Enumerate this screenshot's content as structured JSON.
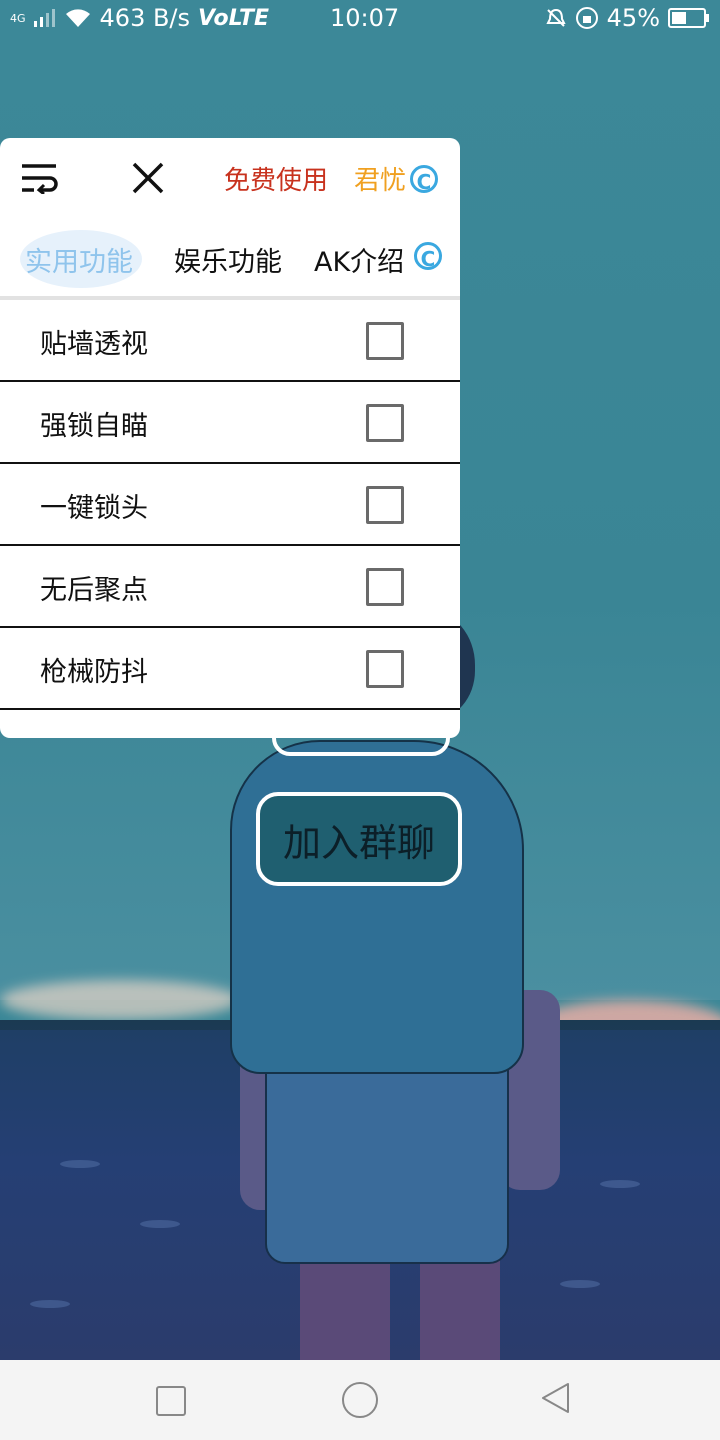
{
  "status_bar": {
    "network": "4G",
    "speed": "463 B/s",
    "volte": "VoLTE",
    "time": "10:07",
    "battery_percent": "45%",
    "battery_level": 0.45
  },
  "panel": {
    "free_label": "免费使用",
    "brand_label": "君忧",
    "brand_icon_letter": "C",
    "tabs": [
      {
        "label": "实用功能",
        "active": true
      },
      {
        "label": "娱乐功能",
        "active": false
      },
      {
        "label": "AK介绍",
        "active": false
      }
    ],
    "tab_icon_letter": "C",
    "items": [
      {
        "label": "贴墙透视",
        "checked": false
      },
      {
        "label": "强锁自瞄",
        "checked": false
      },
      {
        "label": "一键锁头",
        "checked": false
      },
      {
        "label": "无后聚点",
        "checked": false
      },
      {
        "label": "枪械防抖",
        "checked": false
      }
    ]
  },
  "join_button": {
    "label": "加入群聊"
  },
  "colors": {
    "free_label": "#c8321e",
    "brand": "#f0a020",
    "active_tab": "#8fc4ec",
    "icon_blue": "#3aa8e0"
  }
}
